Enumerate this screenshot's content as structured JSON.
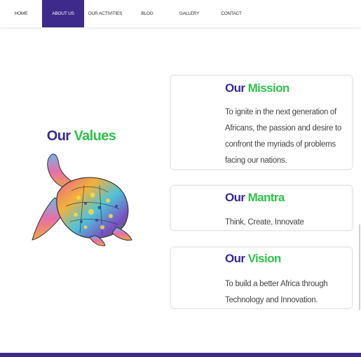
{
  "nav": {
    "items": [
      {
        "label": "HOME",
        "active": false
      },
      {
        "label": "ABOUT US",
        "active": true
      },
      {
        "label": "OUR ACTIVITIES",
        "active": false
      },
      {
        "label": "BLOG",
        "active": false
      },
      {
        "label": "GALLERY",
        "active": false
      },
      {
        "label": "CONTACT",
        "active": false
      }
    ]
  },
  "values": {
    "title_prefix": "Our",
    "title_highlight": "Values"
  },
  "cards": {
    "mission": {
      "title_prefix": "Our",
      "title_highlight": "Mission",
      "text": "To ignite in the next generation of Africans, the passion and desire to confront the myriads of problems facing our nations."
    },
    "mantra": {
      "title_prefix": "Our",
      "title_highlight": "Mantra",
      "text": "Think, Create, Innovate"
    },
    "vision": {
      "title_prefix": "Our",
      "title_highlight": "Vision",
      "text": "To build a better Africa through Technology and Innovation."
    }
  },
  "colors": {
    "brand_purple": "#3d2a8a",
    "accent_green": "#2ec44a"
  }
}
